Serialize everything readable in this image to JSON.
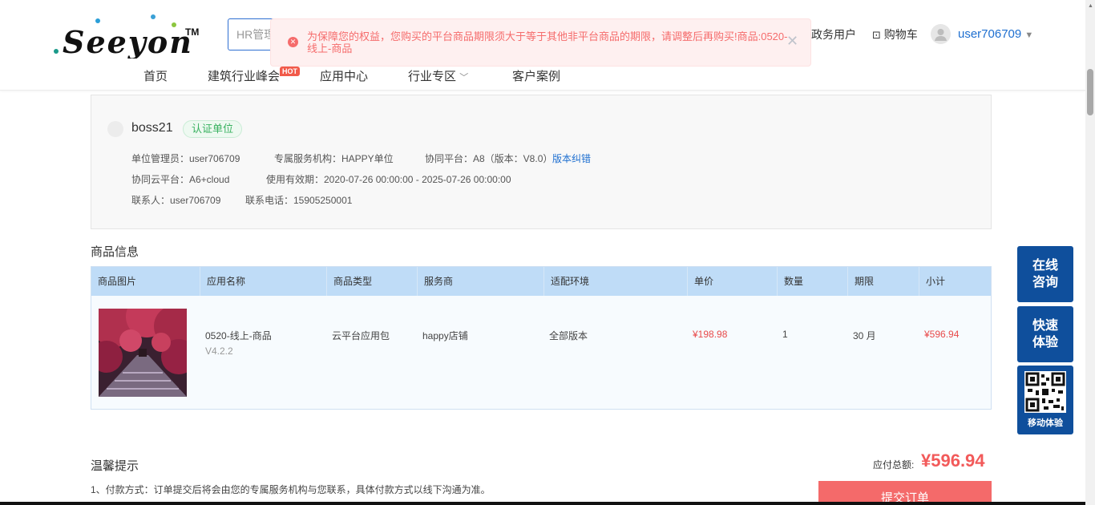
{
  "header": {
    "logo_text": "Seeyon",
    "logo_tm": "TM",
    "search_placeholder": "HR管理",
    "service_user": "政务用户",
    "cart": "购物车",
    "username": "user706709"
  },
  "nav": {
    "items": [
      "首页",
      "建筑行业峰会",
      "应用中心",
      "行业专区",
      "客户案例"
    ],
    "hot": "HOT"
  },
  "alert": {
    "text": "为保障您的权益，您购买的平台商品期限须大于等于其他非平台商品的期限，请调整后再购买!商品:0520-线上-商品"
  },
  "org": {
    "name": "boss21",
    "badge": "认证单位",
    "admin": "单位管理员：user706709",
    "service_org": "专属服务机构：HAPPY单位",
    "platform": "协同平台：A8（版本：V8.0）",
    "fix_link": "版本纠错",
    "cloud": "协同云平台：A6+cloud",
    "validity": "使用有效期：2020-07-26 00:00:00 - 2025-07-26 00:00:00",
    "contact": "联系人：user706709",
    "phone": "联系电话：15905250001"
  },
  "product_section_title": "商品信息",
  "table": {
    "headers": [
      "商品图片",
      "应用名称",
      "商品类型",
      "服务商",
      "适配环境",
      "单价",
      "数量",
      "期限",
      "小计"
    ],
    "row": {
      "name": "0520-线上-商品",
      "version": "V4.2.2",
      "type": "云平台应用包",
      "vendor": "happy店铺",
      "env": "全部版本",
      "price": "¥198.98",
      "qty": "1",
      "period": "30 月",
      "subtotal": "¥596.94"
    }
  },
  "tips": {
    "title": "温馨提示",
    "line1": "1、付款方式：订单提交后将会由您的专属服务机构与您联系，具体付款方式以线下沟通为准。"
  },
  "total": {
    "label": "应付总额:",
    "value": "¥596.94",
    "submit": "提交订单"
  },
  "side": {
    "online_1": "在线",
    "online_2": "咨询",
    "quick_1": "快速",
    "quick_2": "体验",
    "mobile": "移动体验"
  }
}
